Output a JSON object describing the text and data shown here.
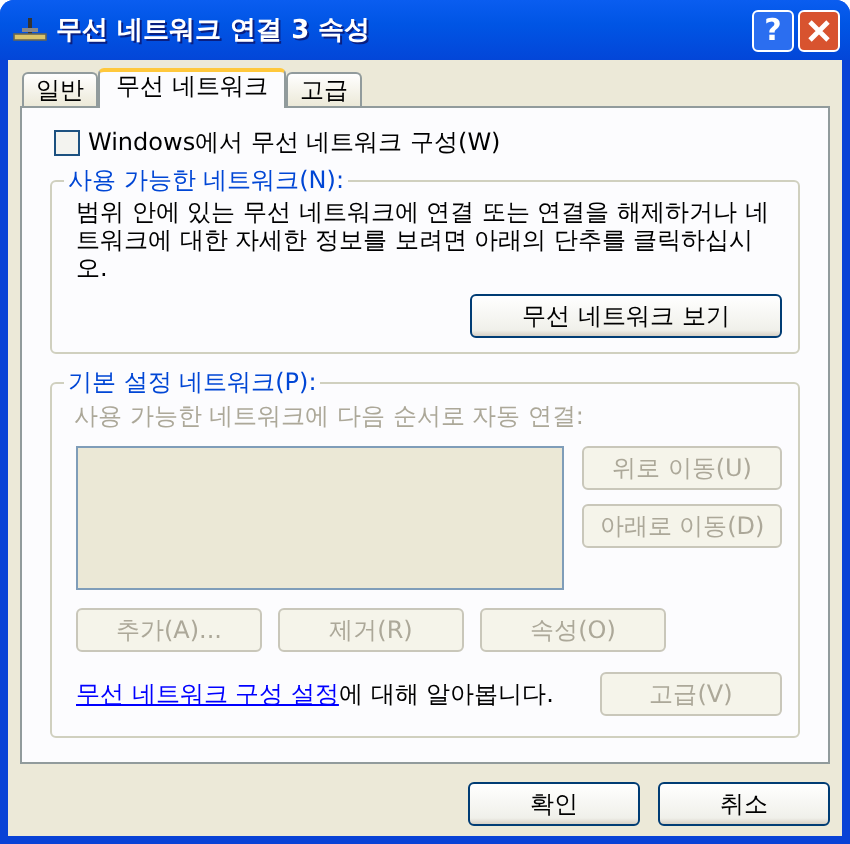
{
  "window": {
    "title": "무선 네트워크 연결 3 속성",
    "help_label": "?"
  },
  "tabs": [
    {
      "label": "일반",
      "selected": false
    },
    {
      "label": "무선 네트워크",
      "selected": true
    },
    {
      "label": "고급",
      "selected": false
    }
  ],
  "wireless_checkbox": {
    "label": "Windows에서 무선 네트워크 구성(W)",
    "checked": false
  },
  "available_networks": {
    "title": "사용 가능한 네트워크(N):",
    "description": "범위 안에 있는 무선 네트워크에 연결 또는 연결을 해제하거나 네트워크에 대한 자세한 정보를 보려면 아래의 단추를 클릭하십시오.",
    "button": {
      "label": "무선 네트워크 보기",
      "disabled": false
    }
  },
  "preferred_networks": {
    "title": "기본 설정 네트워크(P):",
    "hint": "사용 가능한 네트워크에 다음 순서로 자동 연결:",
    "disabled": true,
    "side_buttons": [
      {
        "label": "위로 이동(U)",
        "disabled": true
      },
      {
        "label": "아래로 이동(D)",
        "disabled": true
      }
    ],
    "bottom_buttons": [
      {
        "label": "추가(A)...",
        "disabled": true
      },
      {
        "label": "제거(R)",
        "disabled": true
      },
      {
        "label": "속성(O)",
        "disabled": true
      }
    ],
    "learn_more": {
      "link": "무선 네트워크 구성 설정",
      "text": "에 대해 알아봅니다."
    },
    "advanced_button": {
      "label": "고급(V)",
      "disabled": true
    }
  },
  "footer_buttons": [
    {
      "label": "확인",
      "disabled": false
    },
    {
      "label": "취소",
      "disabled": false
    }
  ]
}
